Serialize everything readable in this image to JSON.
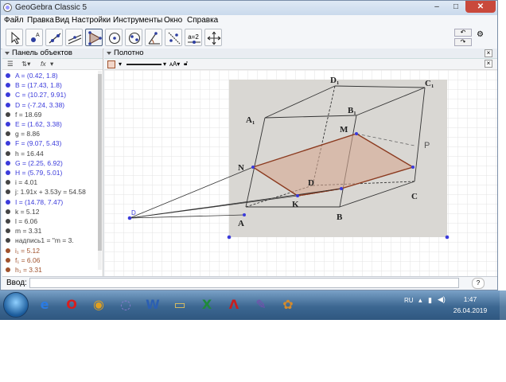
{
  "window": {
    "title": "GeoGebra Classic 5",
    "min": "–",
    "max": "□",
    "close": "✕"
  },
  "menu": [
    "Файл",
    "Правка",
    "Вид",
    "Настройки",
    "Инструменты",
    "Окно",
    "Справка"
  ],
  "toolbar": {
    "undo": "↶",
    "redo": "↷",
    "slider_label": "a=2",
    "settings": "⚙"
  },
  "algebra": {
    "title": "Панель объектов",
    "fx": "fx",
    "objects": [
      {
        "text": "A = (0.42, 1.8)",
        "color": "#3b3bdb"
      },
      {
        "text": "B = (17.43, 1.8)",
        "color": "#3b3bdb"
      },
      {
        "text": "C = (10.27, 9.91)",
        "color": "#3b3bdb"
      },
      {
        "text": "D = (-7.24, 3.38)",
        "color": "#3b3bdb"
      },
      {
        "text": "f = 18.69",
        "color": "#444444"
      },
      {
        "text": "E = (1.62, 3.38)",
        "color": "#3b3bdb"
      },
      {
        "text": "g = 8.86",
        "color": "#444444"
      },
      {
        "text": "F = (9.07, 5.43)",
        "color": "#3b3bdb"
      },
      {
        "text": "h = 16.44",
        "color": "#444444"
      },
      {
        "text": "G = (2.25, 6.92)",
        "color": "#3b3bdb"
      },
      {
        "text": "H = (5.79, 5.01)",
        "color": "#3b3bdb"
      },
      {
        "text": "i = 4.01",
        "color": "#444444"
      },
      {
        "text": "j: 1.91x + 3.53y = 54.58",
        "color": "#444444"
      },
      {
        "text": "I = (14.78, 7.47)",
        "color": "#3b3bdb"
      },
      {
        "text": "k = 5.12",
        "color": "#444444"
      },
      {
        "text": "l = 6.06",
        "color": "#444444"
      },
      {
        "text": "m = 3.31",
        "color": "#444444"
      },
      {
        "text": "надпись1 = \"m = 3.",
        "color": "#444444"
      },
      {
        "text": "i₁ = 5.12",
        "color": "#a0522d"
      },
      {
        "text": "f₁ = 6.06",
        "color": "#a0522d"
      },
      {
        "text": "h₁ = 3.31",
        "color": "#a0522d"
      }
    ]
  },
  "graphics": {
    "title": "Полотно",
    "point_D": "D",
    "photo_labels": {
      "D1": "D₁",
      "C1": "C₁",
      "A1": "A₁",
      "B1": "B₁",
      "M": "M",
      "N": "N",
      "D": "D",
      "K": "K",
      "C": "C",
      "A": "A",
      "B": "B",
      "P": "P"
    }
  },
  "input": {
    "label": "Ввод:",
    "value": "",
    "help": "?"
  },
  "taskbar": {
    "lang": "RU",
    "time": "1:47",
    "date": "26.04.2019",
    "apps": [
      {
        "name": "ie",
        "glyph": "e",
        "color": "#2a7be4"
      },
      {
        "name": "opera",
        "glyph": "O",
        "color": "#d81e1e"
      },
      {
        "name": "chrome",
        "glyph": "◉",
        "color": "#e0a020"
      },
      {
        "name": "geogebra",
        "glyph": "◌",
        "color": "#8a7ad0"
      },
      {
        "name": "word",
        "glyph": "W",
        "color": "#2b5fb3"
      },
      {
        "name": "explorer",
        "glyph": "▭",
        "color": "#e2c25e"
      },
      {
        "name": "excel",
        "glyph": "X",
        "color": "#1f8a3a"
      },
      {
        "name": "pdf",
        "glyph": "Λ",
        "color": "#c81e1e"
      },
      {
        "name": "journal",
        "glyph": "✎",
        "color": "#7a4bb0"
      },
      {
        "name": "paint",
        "glyph": "✿",
        "color": "#d58b2b"
      }
    ]
  }
}
